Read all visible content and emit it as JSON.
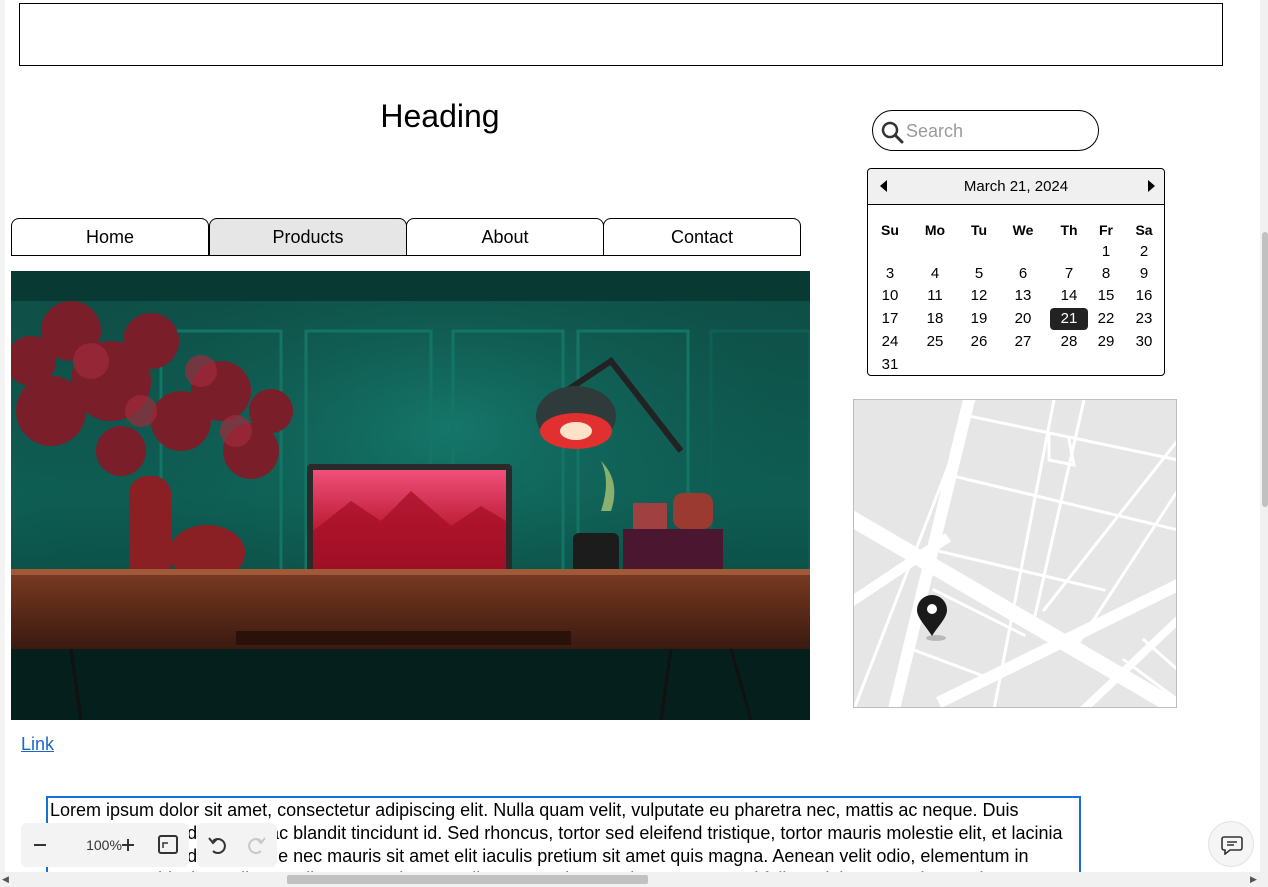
{
  "page": {
    "heading": "Heading",
    "link_text": "Link"
  },
  "nav": {
    "tabs": [
      {
        "label": "Home",
        "active": false
      },
      {
        "label": "Products",
        "active": true
      },
      {
        "label": "About",
        "active": false
      },
      {
        "label": "Contact",
        "active": false
      }
    ]
  },
  "search": {
    "placeholder": "Search",
    "icon": "search-icon"
  },
  "calendar": {
    "title": "March 21, 2024",
    "weekdays": [
      "Su",
      "Mo",
      "Tu",
      "We",
      "Th",
      "Fr",
      "Sa"
    ],
    "weeks": [
      [
        "",
        "",
        "",
        "",
        "",
        "1",
        "2"
      ],
      [
        "3",
        "4",
        "5",
        "6",
        "7",
        "8",
        "9"
      ],
      [
        "10",
        "11",
        "12",
        "13",
        "14",
        "15",
        "16"
      ],
      [
        "17",
        "18",
        "19",
        "20",
        "21",
        "22",
        "23"
      ],
      [
        "24",
        "25",
        "26",
        "27",
        "28",
        "29",
        "30"
      ],
      [
        "31",
        "",
        "",
        "",
        "",
        "",
        ""
      ]
    ],
    "selected_day": "21",
    "selected_color": "#222222"
  },
  "hero_image": {
    "description_icon": "image-icon"
  },
  "textarea": {
    "value": "Lorem ipsum dolor sit amet, consectetur adipiscing elit. Nulla quam velit, vulputate eu pharetra nec, mattis ac neque. Duis vulputate commodo lectus, ac blandit tincidunt id. Sed rhoncus, tortor sed eleifend tristique, tortor mauris molestie elit, et lacinia ipsum quam nec dui. Quisque nec mauris sit amet elit iaculis pretium sit amet quis magna. Aenean velit odio, elementum in tempus ut, vehicula eu diam. Pellentesque rhoncus aliquam mattis. Ut vulputate eros sed felis sodales nec vulputate justo hendrerit. Vivamus",
    "border_color": "#1a6fd6"
  },
  "toolbar": {
    "zoom_value": "100%",
    "zoom_out_icon": "minus-icon",
    "zoom_in_icon": "plus-icon",
    "fit_icon": "fit-screen-icon",
    "undo_icon": "undo-icon",
    "redo_icon": "redo-icon"
  },
  "chat": {
    "icon": "chat-icon"
  },
  "colors": {
    "link": "#1a66c9",
    "active_tab": "#e6e6e6",
    "map_bg": "#e6e6e6"
  }
}
